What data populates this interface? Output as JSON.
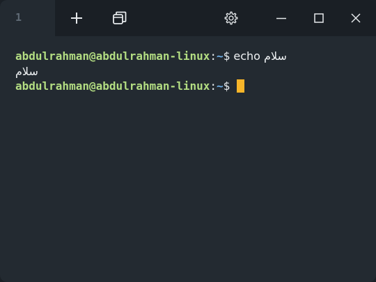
{
  "tabs": [
    {
      "label": "1"
    }
  ],
  "toolbar": {
    "new_tab_icon": "plus-icon",
    "tabs_overview_icon": "window-stack-icon",
    "settings_icon": "gear-icon",
    "minimize_icon": "minimize-icon",
    "maximize_icon": "maximize-icon",
    "close_icon": "close-icon"
  },
  "terminal": {
    "lines": [
      {
        "user_host": "abdulrahman@abdulrahman-linux",
        "colon": ":",
        "path": "~",
        "dollar": "$",
        "command": " echo سلام"
      },
      {
        "output": "سلام"
      },
      {
        "user_host": "abdulrahman@abdulrahman-linux",
        "colon": ":",
        "path": "~",
        "dollar": "$",
        "command": " "
      }
    ]
  },
  "colors": {
    "background": "#232a31",
    "titlebar": "#1a1f25",
    "prompt_user": "#b3dd82",
    "prompt_path": "#6fb0ea",
    "cursor": "#f7b529",
    "text": "#eef1f3"
  }
}
